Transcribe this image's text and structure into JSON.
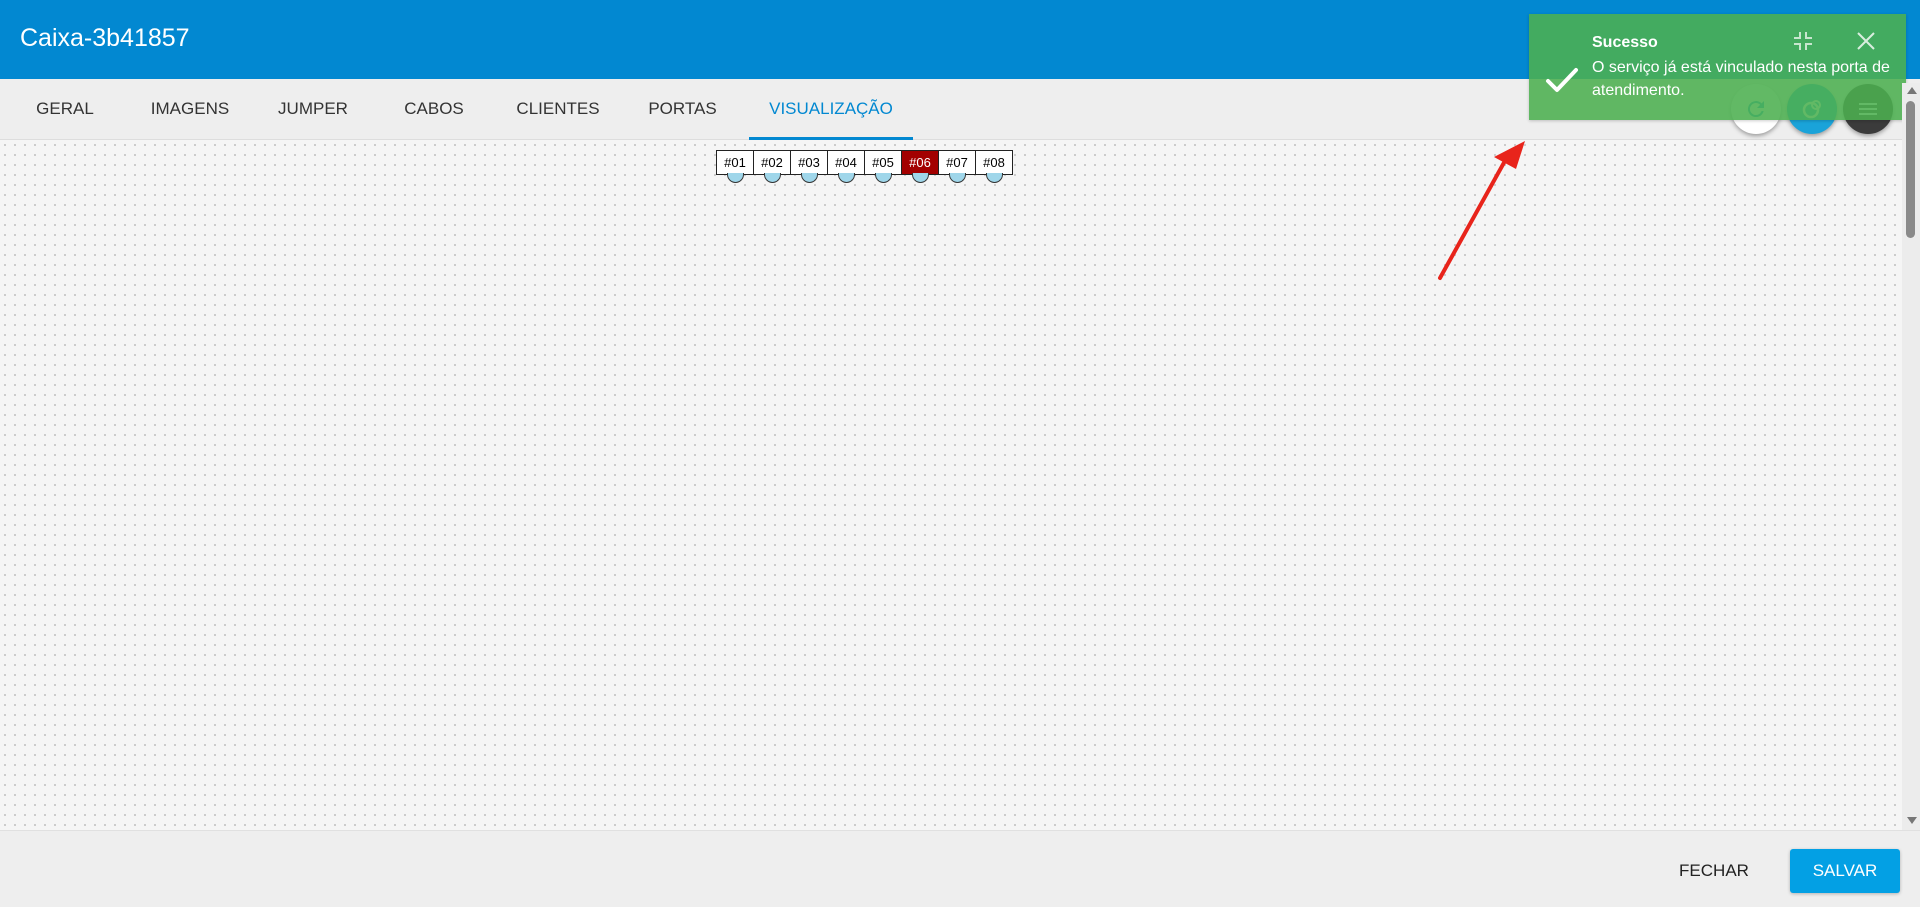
{
  "header": {
    "title": "Caixa-3b41857"
  },
  "tabs": [
    {
      "label": "GERAL",
      "active": false
    },
    {
      "label": "IMAGENS",
      "active": false
    },
    {
      "label": "JUMPER",
      "active": false
    },
    {
      "label": "CABOS",
      "active": false
    },
    {
      "label": "CLIENTES",
      "active": false
    },
    {
      "label": "PORTAS",
      "active": false
    },
    {
      "label": "VISUALIZAÇÃO",
      "active": true
    }
  ],
  "ports": [
    {
      "label": "#01",
      "selected": false
    },
    {
      "label": "#02",
      "selected": false
    },
    {
      "label": "#03",
      "selected": false
    },
    {
      "label": "#04",
      "selected": false
    },
    {
      "label": "#05",
      "selected": false
    },
    {
      "label": "#06",
      "selected": true
    },
    {
      "label": "#07",
      "selected": false
    },
    {
      "label": "#08",
      "selected": false
    }
  ],
  "toolbar": {
    "refresh_icon": "refresh-icon",
    "link_icon": "link-service-icon",
    "menu_icon": "menu-icon"
  },
  "toast": {
    "title": "Sucesso",
    "message": "O serviço já está vinculado nesta porta de atendimento.",
    "color": "#4caf50"
  },
  "footer": {
    "close_label": "FECHAR",
    "save_label": "SALVAR"
  },
  "colors": {
    "header": "#0288d1",
    "selected_port": "#a30000",
    "save_button": "#03a0e4",
    "annotation_arrow": "#e8241b"
  }
}
